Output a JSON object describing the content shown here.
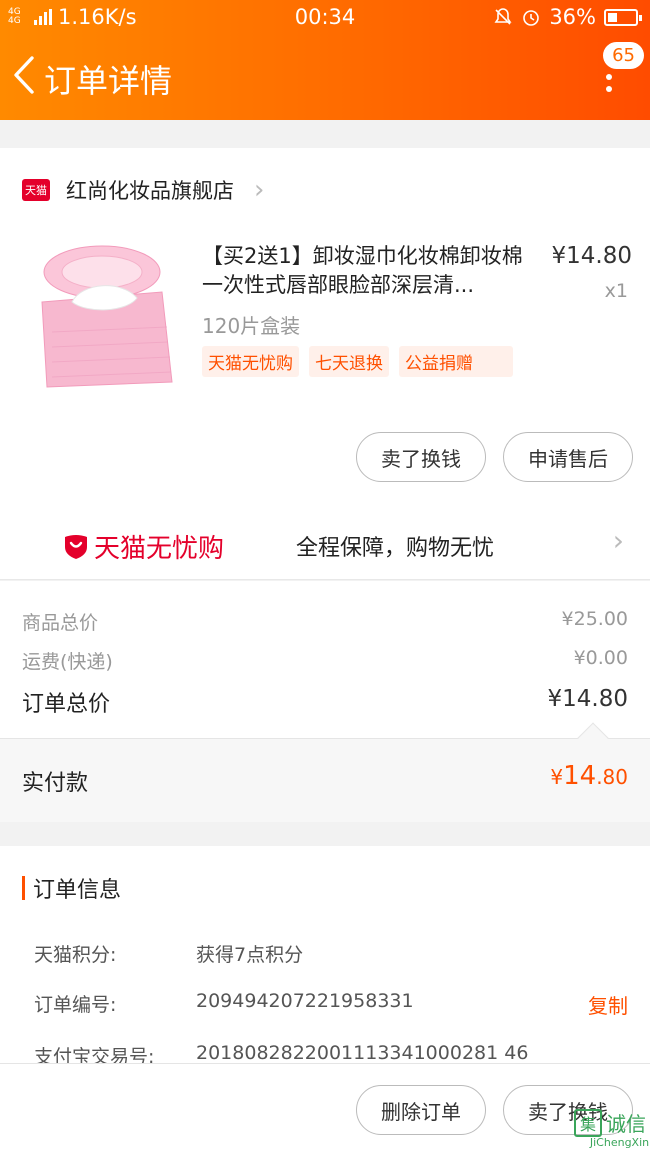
{
  "status_bar": {
    "network": "4G 4G",
    "speed": "1.16K/s",
    "time": "00:34",
    "battery": "36%",
    "battery_level": 0.36
  },
  "nav": {
    "title": "订单详情",
    "badge": "65"
  },
  "shop": {
    "logo_text": "天猫",
    "name": "红尚化妆品旗舰店"
  },
  "product": {
    "title": "【买2送1】卸妆湿巾化妆棉卸妆棉一次性式唇部眼脸部深层清...",
    "price": "¥14.80",
    "qty": "x1",
    "spec": "120片盒装",
    "tags": [
      "天猫无忧购",
      "七天退换",
      "公益捐赠"
    ]
  },
  "item_actions": {
    "sell_label": "卖了换钱",
    "aftersale_label": "申请售后"
  },
  "guarantee": {
    "brand": "天猫无忧购",
    "text": "全程保障，购物无忧"
  },
  "fees": {
    "goods_label": "商品总价",
    "goods_value": "¥25.00",
    "shipping_label": "运费(快递)",
    "shipping_value": "¥0.00",
    "total_label": "订单总价",
    "total_value": "¥14.80"
  },
  "paid": {
    "label": "实付款",
    "symbol": "¥",
    "int": "14",
    "dec": ".80"
  },
  "order_info": {
    "title": "订单信息",
    "rows": [
      {
        "key": "天猫积分:",
        "value": "获得7点积分"
      },
      {
        "key": "订单编号:",
        "value": "209494207221958331",
        "action": "复制"
      },
      {
        "key": "支付宝交易号:",
        "value": "2018082822001113341000281 46"
      }
    ]
  },
  "bottom_bar": {
    "delete_label": "删除订单",
    "sell_label": "卖了换钱"
  },
  "watermark": {
    "char": "集",
    "text": "诚信",
    "url": "JiChengXin.com"
  },
  "colors": {
    "accent": "#ff5000",
    "topbar_start": "#ff8a00",
    "topbar_end": "#ff4c00",
    "tmall_red": "#e4002b"
  }
}
